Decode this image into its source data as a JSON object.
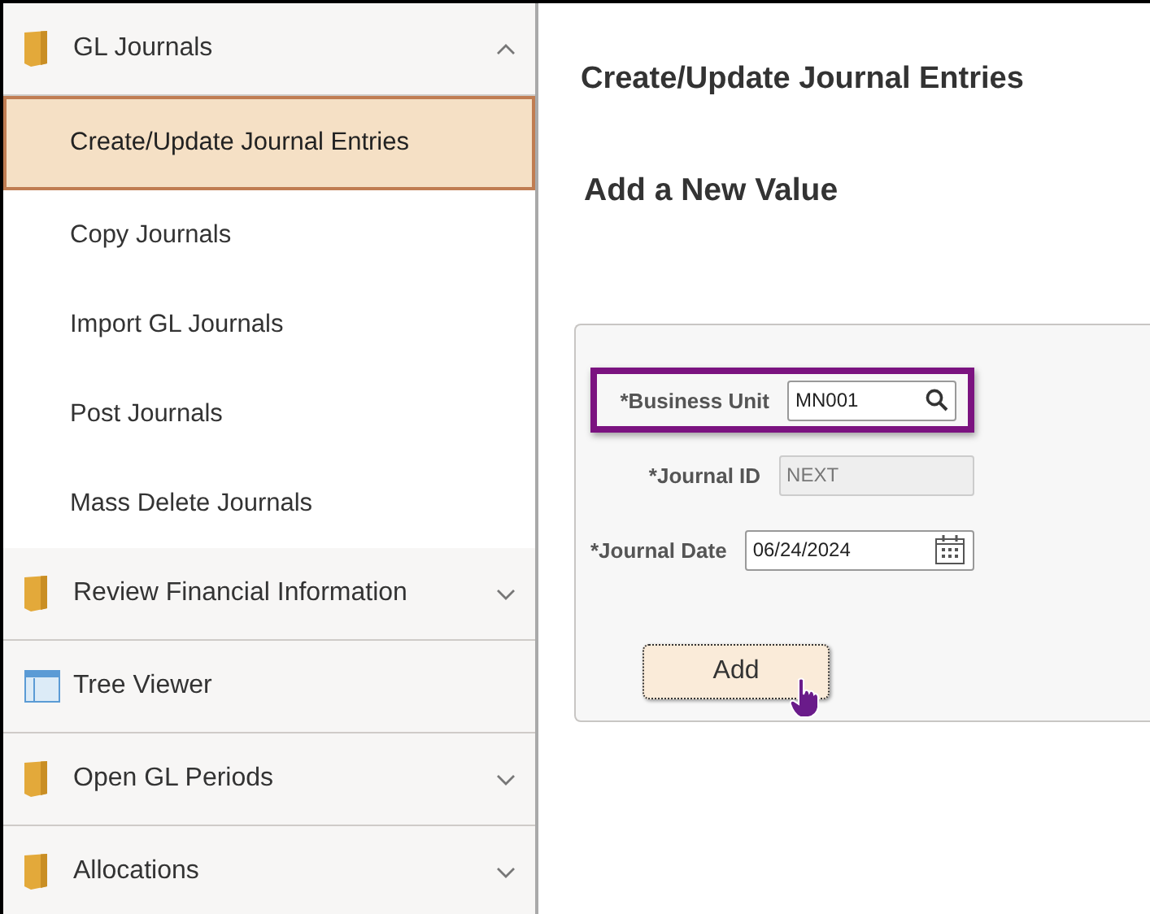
{
  "sidebar": {
    "sections": [
      {
        "kind": "folder",
        "label": "GL Journals",
        "expanded": true,
        "items": [
          {
            "label": "Create/Update Journal Entries",
            "selected": true
          },
          {
            "label": "Copy Journals",
            "selected": false
          },
          {
            "label": "Import GL Journals",
            "selected": false
          },
          {
            "label": "Post Journals",
            "selected": false
          },
          {
            "label": "Mass Delete Journals",
            "selected": false
          }
        ]
      },
      {
        "kind": "folder",
        "label": "Review Financial Information",
        "expanded": false
      },
      {
        "kind": "page",
        "label": "Tree Viewer"
      },
      {
        "kind": "folder",
        "label": "Open GL Periods",
        "expanded": false
      },
      {
        "kind": "folder",
        "label": "Allocations",
        "expanded": false
      }
    ]
  },
  "page": {
    "title": "Create/Update Journal Entries",
    "subtitle": "Add a New Value",
    "fields": [
      {
        "kind": "lookup",
        "label": "*Business Unit",
        "value": "MN001",
        "disabled": false,
        "highlighted": true
      },
      {
        "kind": "text",
        "label": "*Journal ID",
        "value": "NEXT",
        "disabled": true,
        "highlighted": false
      },
      {
        "kind": "date",
        "label": "*Journal Date",
        "value": "06/24/2024",
        "disabled": false,
        "highlighted": false
      }
    ],
    "button": {
      "label": "Add",
      "hovered": true
    }
  }
}
